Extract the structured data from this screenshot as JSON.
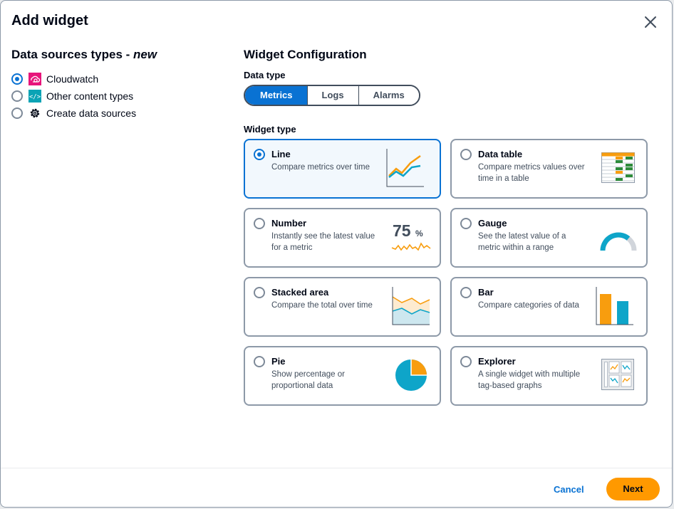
{
  "modal": {
    "title": "Add widget"
  },
  "data_sources": {
    "heading": "Data sources types - ",
    "heading_new": "new",
    "items": [
      {
        "label": "Cloudwatch",
        "icon": "cloudwatch-icon",
        "selected": true
      },
      {
        "label": "Other content types",
        "icon": "code-icon",
        "selected": false
      },
      {
        "label": "Create data sources",
        "icon": "gear-icon",
        "selected": false
      }
    ]
  },
  "config": {
    "heading": "Widget Configuration",
    "data_type_label": "Data type",
    "data_types": [
      "Metrics",
      "Logs",
      "Alarms"
    ],
    "selected_data_type": "Metrics",
    "widget_type_label": "Widget type",
    "widgets": [
      {
        "title": "Line",
        "desc": "Compare metrics over time",
        "selected": true
      },
      {
        "title": "Data table",
        "desc": "Compare metrics values over time in a table",
        "selected": false
      },
      {
        "title": "Number",
        "desc": "Instantly see the latest value for a metric",
        "selected": false,
        "preview_value": "75",
        "preview_unit": "%"
      },
      {
        "title": "Gauge",
        "desc": "See the latest value of a metric within a range",
        "selected": false
      },
      {
        "title": "Stacked area",
        "desc": "Compare the total over time",
        "selected": false
      },
      {
        "title": "Bar",
        "desc": "Compare categories of data",
        "selected": false
      },
      {
        "title": "Pie",
        "desc": "Show percentage or proportional data",
        "selected": false
      },
      {
        "title": "Explorer",
        "desc": "A single widget with multiple tag-based graphs",
        "selected": false
      }
    ]
  },
  "footer": {
    "cancel_label": "Cancel",
    "next_label": "Next"
  },
  "colors": {
    "accent": "#0972d3",
    "primary_button": "#ff9900",
    "chart_orange": "#f89d0e",
    "chart_teal": "#0ea5c9"
  }
}
